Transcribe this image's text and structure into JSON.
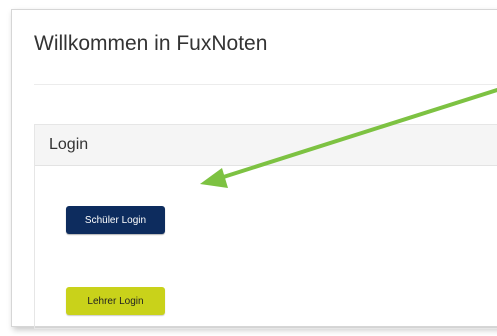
{
  "page": {
    "title": "Willkommen in FuxNoten"
  },
  "login_panel": {
    "heading": "Login",
    "student_button_label": "Schüler Login",
    "teacher_button_label": "Lehrer Login"
  },
  "colors": {
    "student_button": "#0d2c5e",
    "teacher_button": "#c9d21a",
    "annotation_arrow": "#7dc242"
  }
}
